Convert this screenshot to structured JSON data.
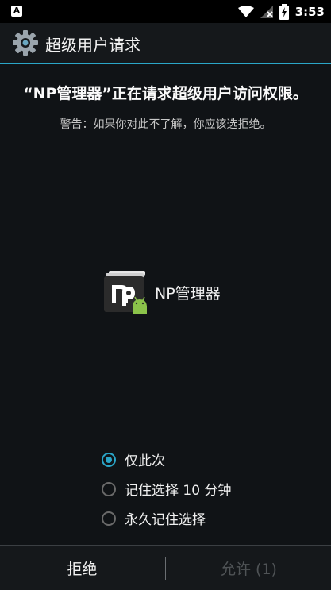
{
  "status_bar": {
    "notification_icon": "font-notification-icon",
    "time": "3:53",
    "icons": [
      "wifi-icon",
      "signal-no-sim-icon",
      "battery-charging-icon"
    ]
  },
  "titlebar": {
    "icon": "gear-icon",
    "title": "超级用户请求"
  },
  "request": {
    "title": "“NP管理器”正在请求超级用户访问权限。",
    "warning": "警告：如果你对此不了解，你应该选拒绝。"
  },
  "app": {
    "icon": "np-manager-app-icon",
    "name": "NP管理器"
  },
  "options": [
    {
      "label": "仅此次",
      "selected": true
    },
    {
      "label": "记住选择 10 分钟",
      "selected": false
    },
    {
      "label": "永久记住选择",
      "selected": false
    }
  ],
  "buttons": {
    "deny": "拒绝",
    "allow": "允许 (1)"
  },
  "colors": {
    "accent": "#2aa6c8",
    "background": "#101316",
    "disabled_text": "#4f5356"
  }
}
